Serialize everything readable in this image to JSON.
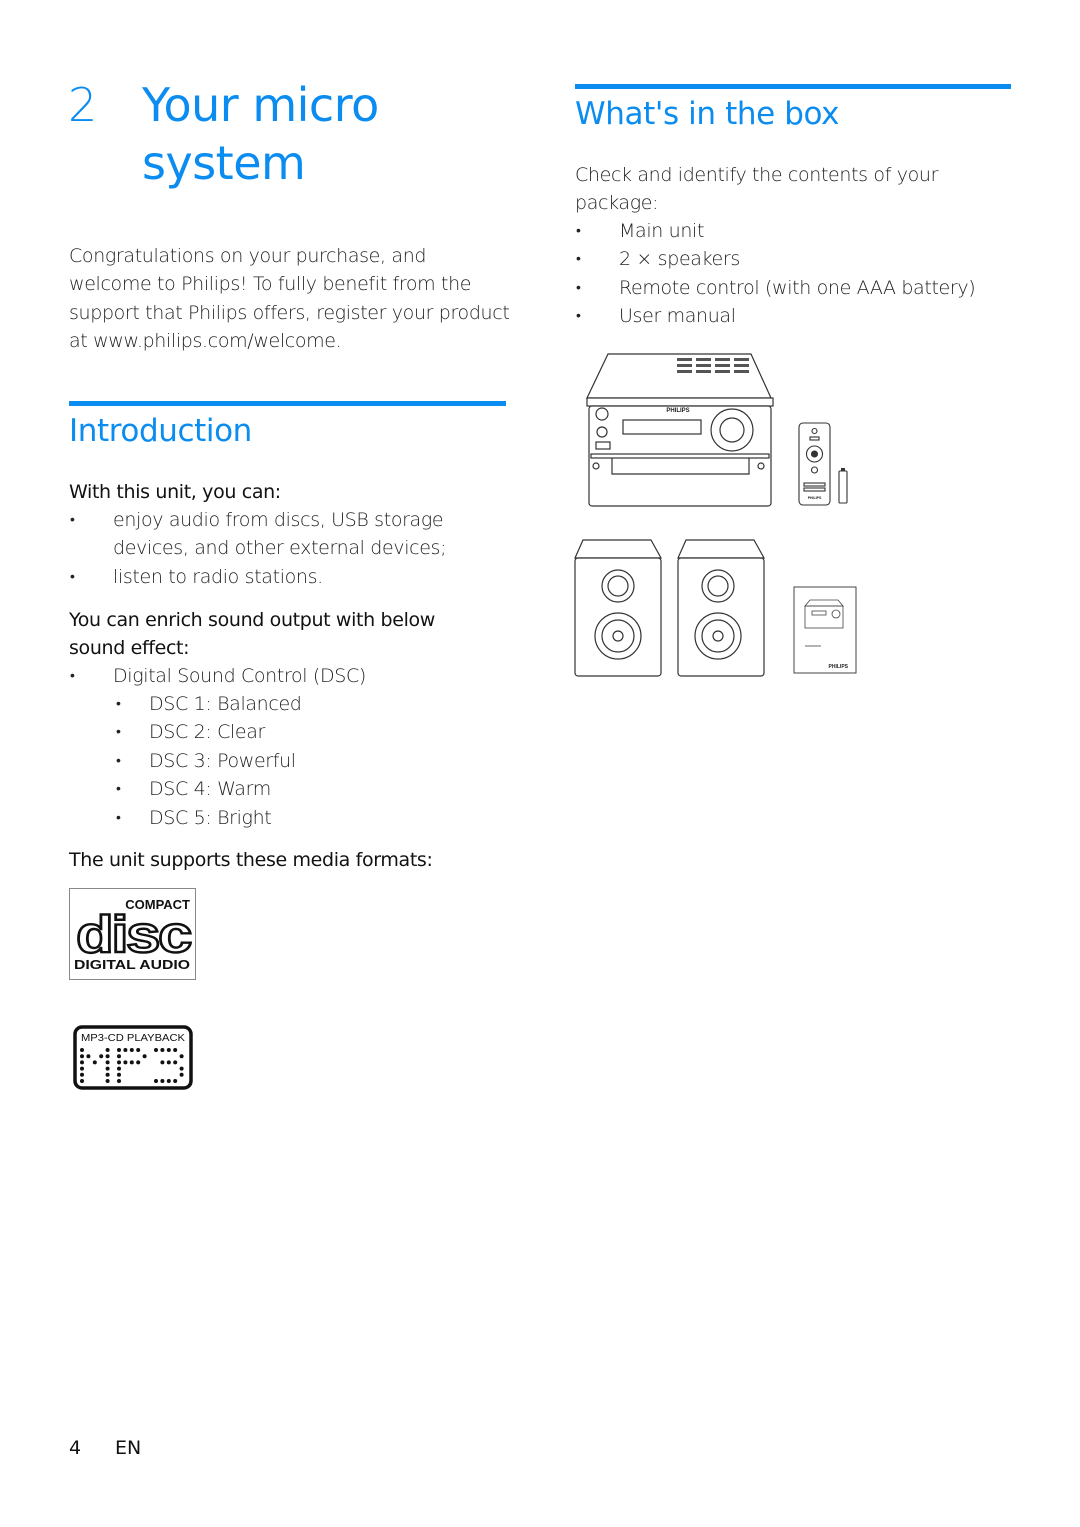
{
  "chapter": {
    "number": "2",
    "title_line1": "Your micro",
    "title_line2": "system"
  },
  "intro_paragraph": [
    "Congratulations on your purchase, and",
    "welcome to Philips! To fully benefit from the",
    "support that Philips offers, register your product",
    "at www.philips.com/welcome."
  ],
  "introduction": {
    "heading": "Introduction",
    "lead1": "With this unit, you can:",
    "features": [
      [
        "enjoy audio from discs, USB storage",
        "devices, and other external devices;"
      ],
      [
        "listen to radio stations."
      ]
    ],
    "lead2_line1": "You can enrich sound output with below",
    "lead2_line2": "sound effect:",
    "dsc_main": "Digital Sound Control (DSC)",
    "dsc_modes": [
      "DSC 1: Balanced",
      "DSC 2: Clear",
      "DSC 3: Powerful",
      "DSC 4: Warm",
      "DSC 5: Bright"
    ],
    "lead3": "The unit supports these media formats:",
    "logos": {
      "cd_top": "COMPACT",
      "cd_middle": "disc",
      "cd_bottom": "DIGITAL AUDIO",
      "mp3_top": "MP3-CD PLAYBACK",
      "mp3_middle": "MP3"
    }
  },
  "whats_in_box": {
    "heading": "What's in the box",
    "intro_line1": "Check and identify the contents of your",
    "intro_line2": "package:",
    "items": [
      "Main unit",
      "2 × speakers",
      "Remote control (with one AAA battery)",
      "User manual"
    ],
    "illustration_brand": "PHILIPS"
  },
  "footer": {
    "page_number": "4",
    "language": "EN"
  }
}
